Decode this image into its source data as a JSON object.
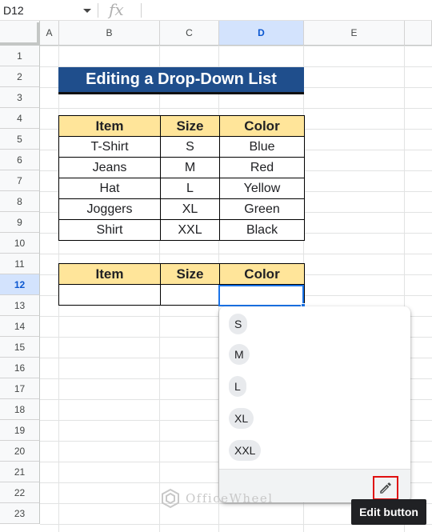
{
  "formula_bar": {
    "cell_ref": "D12",
    "fx_label": "fx",
    "formula": ""
  },
  "columns": [
    "A",
    "B",
    "C",
    "D",
    "E"
  ],
  "active_column": "D",
  "rows": [
    "1",
    "2",
    "3",
    "4",
    "5",
    "6",
    "7",
    "8",
    "9",
    "10",
    "11",
    "12",
    "13",
    "14",
    "15",
    "16",
    "17",
    "18",
    "19",
    "20",
    "21",
    "22",
    "23"
  ],
  "active_row": "12",
  "title": "Editing a Drop-Down List",
  "table1": {
    "headers": [
      "Item",
      "Size",
      "Color"
    ],
    "rows": [
      [
        "T-Shirt",
        "S",
        "Blue"
      ],
      [
        "Jeans",
        "M",
        "Red"
      ],
      [
        "Hat",
        "L",
        "Yellow"
      ],
      [
        "Joggers",
        "XL",
        "Green"
      ],
      [
        "Shirt",
        "XXL",
        "Black"
      ]
    ]
  },
  "table2": {
    "headers": [
      "Item",
      "Size",
      "Color"
    ],
    "rows": [
      [
        "",
        "",
        ""
      ]
    ]
  },
  "dropdown": {
    "options": [
      "S",
      "M",
      "L",
      "XL",
      "XXL"
    ],
    "edit_icon": "pencil-icon"
  },
  "tooltip": "Edit button",
  "watermark": "OfficeWheel",
  "colors": {
    "title_bg": "#1f4e8c",
    "header_bg": "#ffe59a",
    "selection": "#1a73e8",
    "edit_highlight": "#e01010"
  }
}
